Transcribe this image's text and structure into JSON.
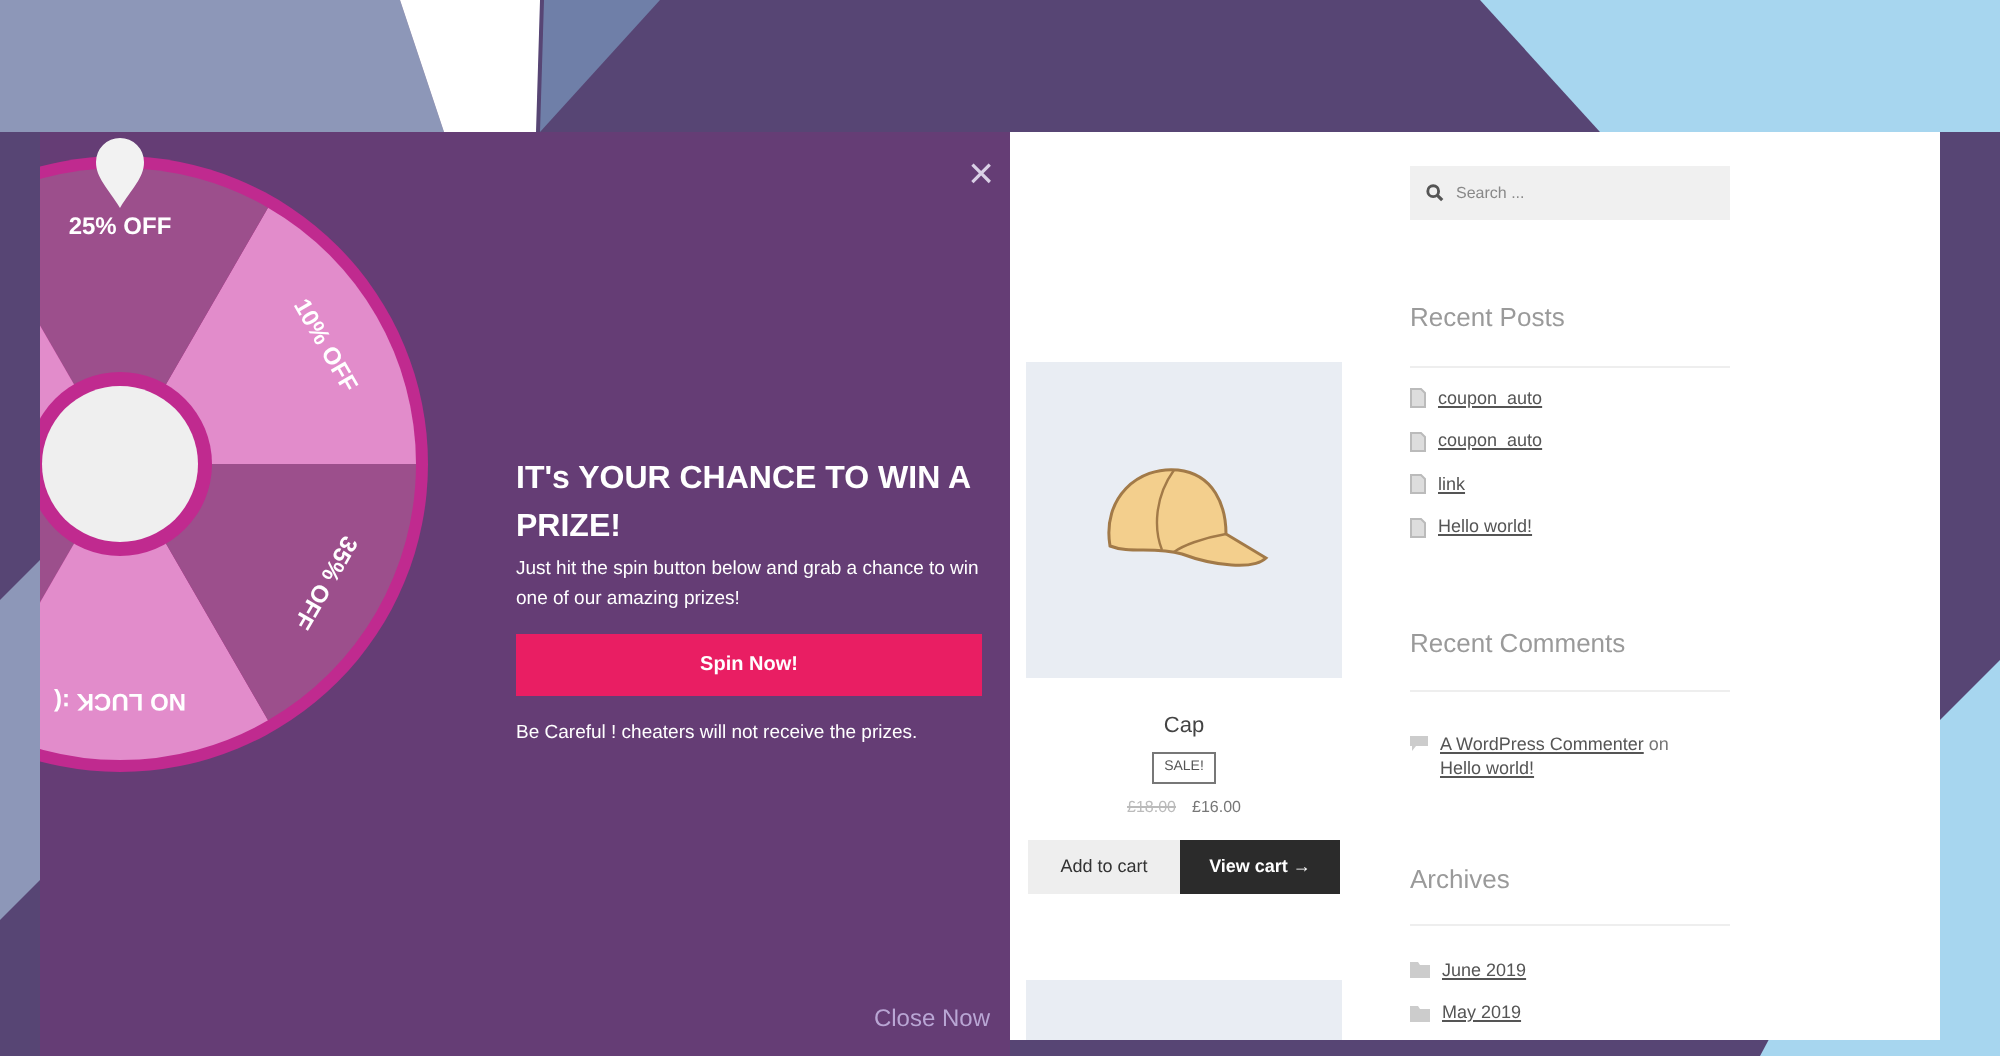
{
  "popup": {
    "close_icon": "×",
    "wheel": {
      "segments": [
        {
          "label": "10% OFF",
          "color": "#e28ccb"
        },
        {
          "label": "25% OFF",
          "color": "#9c4f8c"
        },
        {
          "color": "#e28ccb"
        },
        {
          "color": "#9c4f8c"
        },
        {
          "label": "NO LUCK :(",
          "color": "#e28ccb"
        },
        {
          "label": "35% OFF",
          "color": "#9c4f8c"
        }
      ]
    },
    "title": "IT's YOUR CHANCE TO WIN A PRIZE!",
    "description": "Just hit the spin button below and grab a chance to win one of our amazing prizes!",
    "spin_button": "Spin Now!",
    "warning": "Be Careful ! cheaters will not receive the prizes.",
    "close_link": "Close Now"
  },
  "shop": {
    "product": {
      "name": "Cap",
      "badge": "SALE!",
      "old_price": "£18.00",
      "price": "£16.00",
      "add_button": "Add to cart",
      "view_button": "View cart →"
    },
    "sidebar": {
      "search": {
        "placeholder": "Search ..."
      },
      "recent_posts": {
        "title": "Recent Posts",
        "items": [
          "coupon_auto",
          "coupon_auto",
          "link",
          "Hello world!"
        ]
      },
      "recent_comments": {
        "title": "Recent Comments",
        "items": [
          {
            "author": "A WordPress Commenter",
            "joiner": "on",
            "post": "Hello world!"
          }
        ]
      },
      "archives": {
        "title": "Archives",
        "items": [
          "June 2019",
          "May 2019"
        ]
      }
    }
  }
}
